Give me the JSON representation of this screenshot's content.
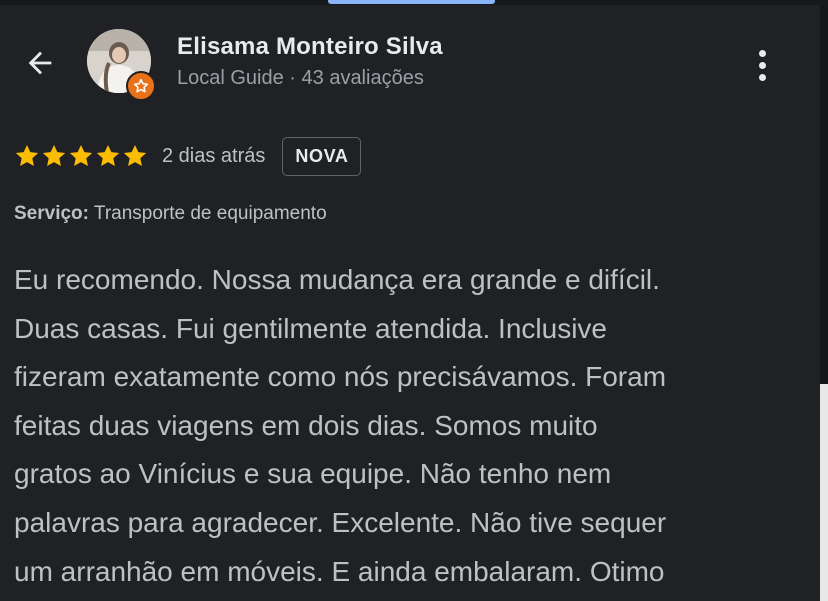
{
  "header": {
    "name": "Elisama Monteiro Silva",
    "subtitle": "Local Guide · 43 avaliações",
    "icons": {
      "back": "arrow-back-icon",
      "avatar": "profile-photo",
      "badge": "local-guide-star-icon",
      "more": "more-vert-icon"
    }
  },
  "review": {
    "rating": 5,
    "date": "2 dias atrás",
    "badge": "NOVA",
    "service_label": "Serviço:",
    "service_value": " Transporte de equipamento",
    "text_lines": [
      "Eu recomendo. Nossa mudança era grande e difícil.",
      "Duas casas. Fui gentilmente atendida. Inclusive",
      "fizeram exatamente como nós precisávamos. Foram",
      "feitas duas viagens em dois dias. Somos muito",
      "gratos ao Vinícius e sua equipe. Não tenho nem",
      "palavras para agradecer. Excelente. Não tive sequer",
      "um arranhão em móveis. E ainda embalaram. Otimo"
    ]
  },
  "colors": {
    "background": "#202124",
    "star": "#fbbc04",
    "guide_badge": "#e8711a",
    "primary_text": "#e8eaed",
    "secondary_text": "#9aa0a6",
    "accent": "#8ab4f8"
  }
}
